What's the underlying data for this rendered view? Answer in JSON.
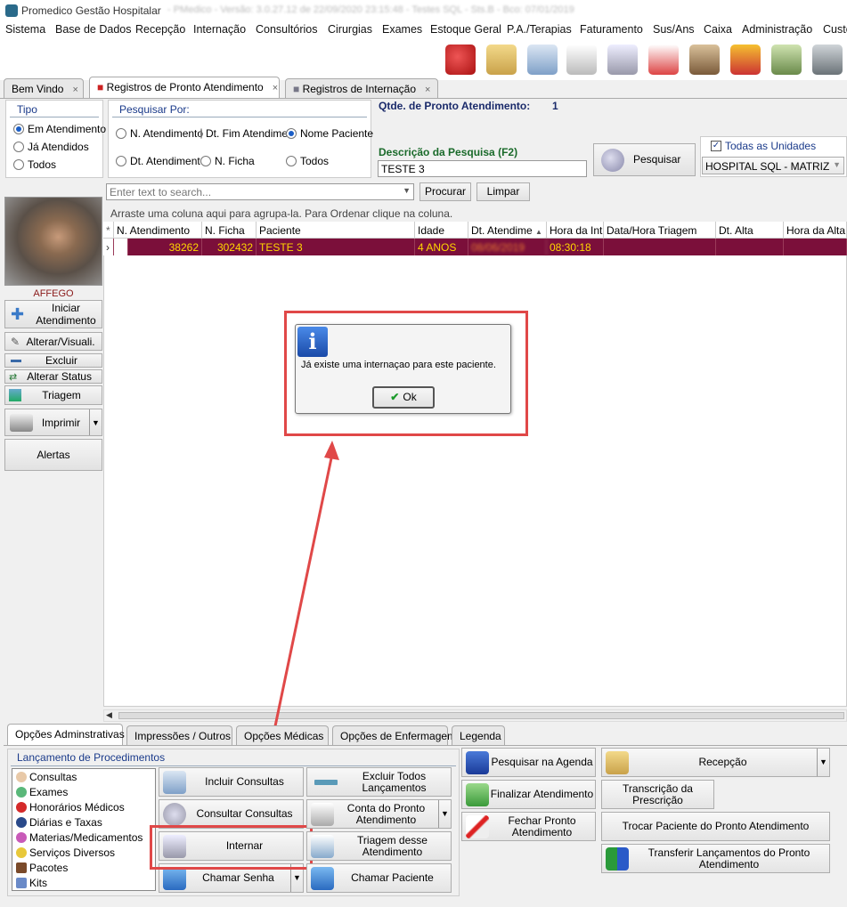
{
  "window": {
    "title": "Promedico Gestão Hospitalar",
    "title_rest": "- PMedico - Versão: 3.0.27.12 de 22/09/2020 23:15:48 - Testes SQL - Sts.B - Bco: 07/01/2019"
  },
  "menu": [
    "Sistema",
    "Base de Dados",
    "Recepção",
    "Internação",
    "Consultórios",
    "Cirurgias",
    "Exames",
    "Estoque Geral",
    "P.A./Terapias",
    "Faturamento",
    "Sus/Ans",
    "Caixa",
    "Administração",
    "Custos"
  ],
  "toolbar_icons": [
    "refresh-icon",
    "agenda-icon",
    "doctor-icon",
    "document-icon",
    "bed-icon",
    "ambulance-icon",
    "building-icon",
    "chart-up-icon",
    "money-icon",
    "safe-icon"
  ],
  "tabs": [
    {
      "label": "Bem Vindo",
      "close": "×"
    },
    {
      "label": "Registros de Pronto Atendimento",
      "close": "×"
    },
    {
      "label": "Registros de Internação",
      "close": "×"
    }
  ],
  "tipo": {
    "title": "Tipo",
    "options": [
      "Em Atendimento",
      "Já Atendidos",
      "Todos"
    ],
    "selected": "Em Atendimento"
  },
  "pesquisar_por": {
    "title": "Pesquisar Por:",
    "options": [
      "N. Atendimento",
      "Dt. Fim Atendime",
      "Nome Paciente",
      "Dt. Atendimento",
      "N. Ficha",
      "Todos"
    ],
    "selected": "Nome Paciente"
  },
  "summary": {
    "label": "Qtde. de Pronto Atendimento:",
    "value": "1"
  },
  "search": {
    "label": "Descrição da Pesquisa (F2)",
    "value": "TESTE 3",
    "button": "Pesquisar"
  },
  "unidades": {
    "checkbox_label": "Todas as Unidades",
    "checked": true,
    "selected": "HOSPITAL SQL - MATRIZ"
  },
  "filter": {
    "placeholder": "Enter text to search...",
    "procurar": "Procurar",
    "limpar": "Limpar"
  },
  "group_hint": "Arraste uma coluna aqui para agrupa-la. Para Ordenar clique na coluna.",
  "table": {
    "columns": [
      "N. Atendimento",
      "N. Ficha",
      "Paciente",
      "Idade",
      "Dt. Atendime",
      "Hora da Int",
      "Data/Hora Triagem",
      "Dt. Alta",
      "Hora da Alta"
    ],
    "rows": [
      {
        "atendimento": "38262",
        "ficha": "302432",
        "paciente": "TESTE 3",
        "idade": "4 ANOS",
        "dt": "08/06/2019",
        "hora": "08:30:18",
        "triagem": "",
        "alta": "",
        "hora_alta": ""
      }
    ]
  },
  "sidebar": {
    "user": "AFFEGO",
    "buttons": {
      "iniciar": "Iniciar Atendimento",
      "alterar": "Alterar/Visuali.",
      "excluir": "Excluir",
      "status": "Alterar Status",
      "triagem": "Triagem",
      "imprimir": "Imprimir",
      "alertas": "Alertas"
    }
  },
  "dialog": {
    "message": "Já existe uma internaçao para este paciente.",
    "ok": "Ok"
  },
  "bottom_tabs": [
    "Opções Adminstrativas",
    "Impressões / Outros",
    "Opções Médicas",
    "Opções de Enfermagem",
    "Legenda"
  ],
  "lancamento": {
    "title": "Lançamento de Procedimentos",
    "items": [
      "Consultas",
      "Exames",
      "Honorários Médicos",
      "Diárias e Taxas",
      "Materias/Medicamentos",
      "Serviços Diversos",
      "Pacotes",
      "Kits"
    ]
  },
  "actions": {
    "incluir": "Incluir Consultas",
    "excluir_todos": "Excluir Todos Lançamentos",
    "consultar": "Consultar Consultas",
    "conta": "Conta do Pronto Atendimento",
    "internar": "Internar",
    "triagem_desse": "Triagem desse Atendimento",
    "chamar_senha": "Chamar Senha",
    "chamar_paciente": "Chamar Paciente",
    "pesquisar_agenda": "Pesquisar na Agenda",
    "finalizar": "Finalizar Atendimento",
    "fechar": "Fechar Pronto Atendimento",
    "recepcao": "Recepção",
    "transcricao": "Transcrição da Prescrição",
    "trocar": "Trocar Paciente do Pronto Atendimento",
    "transferir": "Transferir Lançamentos do Pronto Atendimento"
  },
  "colors": {
    "selected_row": "#7b0f3a",
    "row_text": "#ffd700",
    "highlight": "#e04848",
    "group_title": "#1a3a8a"
  }
}
